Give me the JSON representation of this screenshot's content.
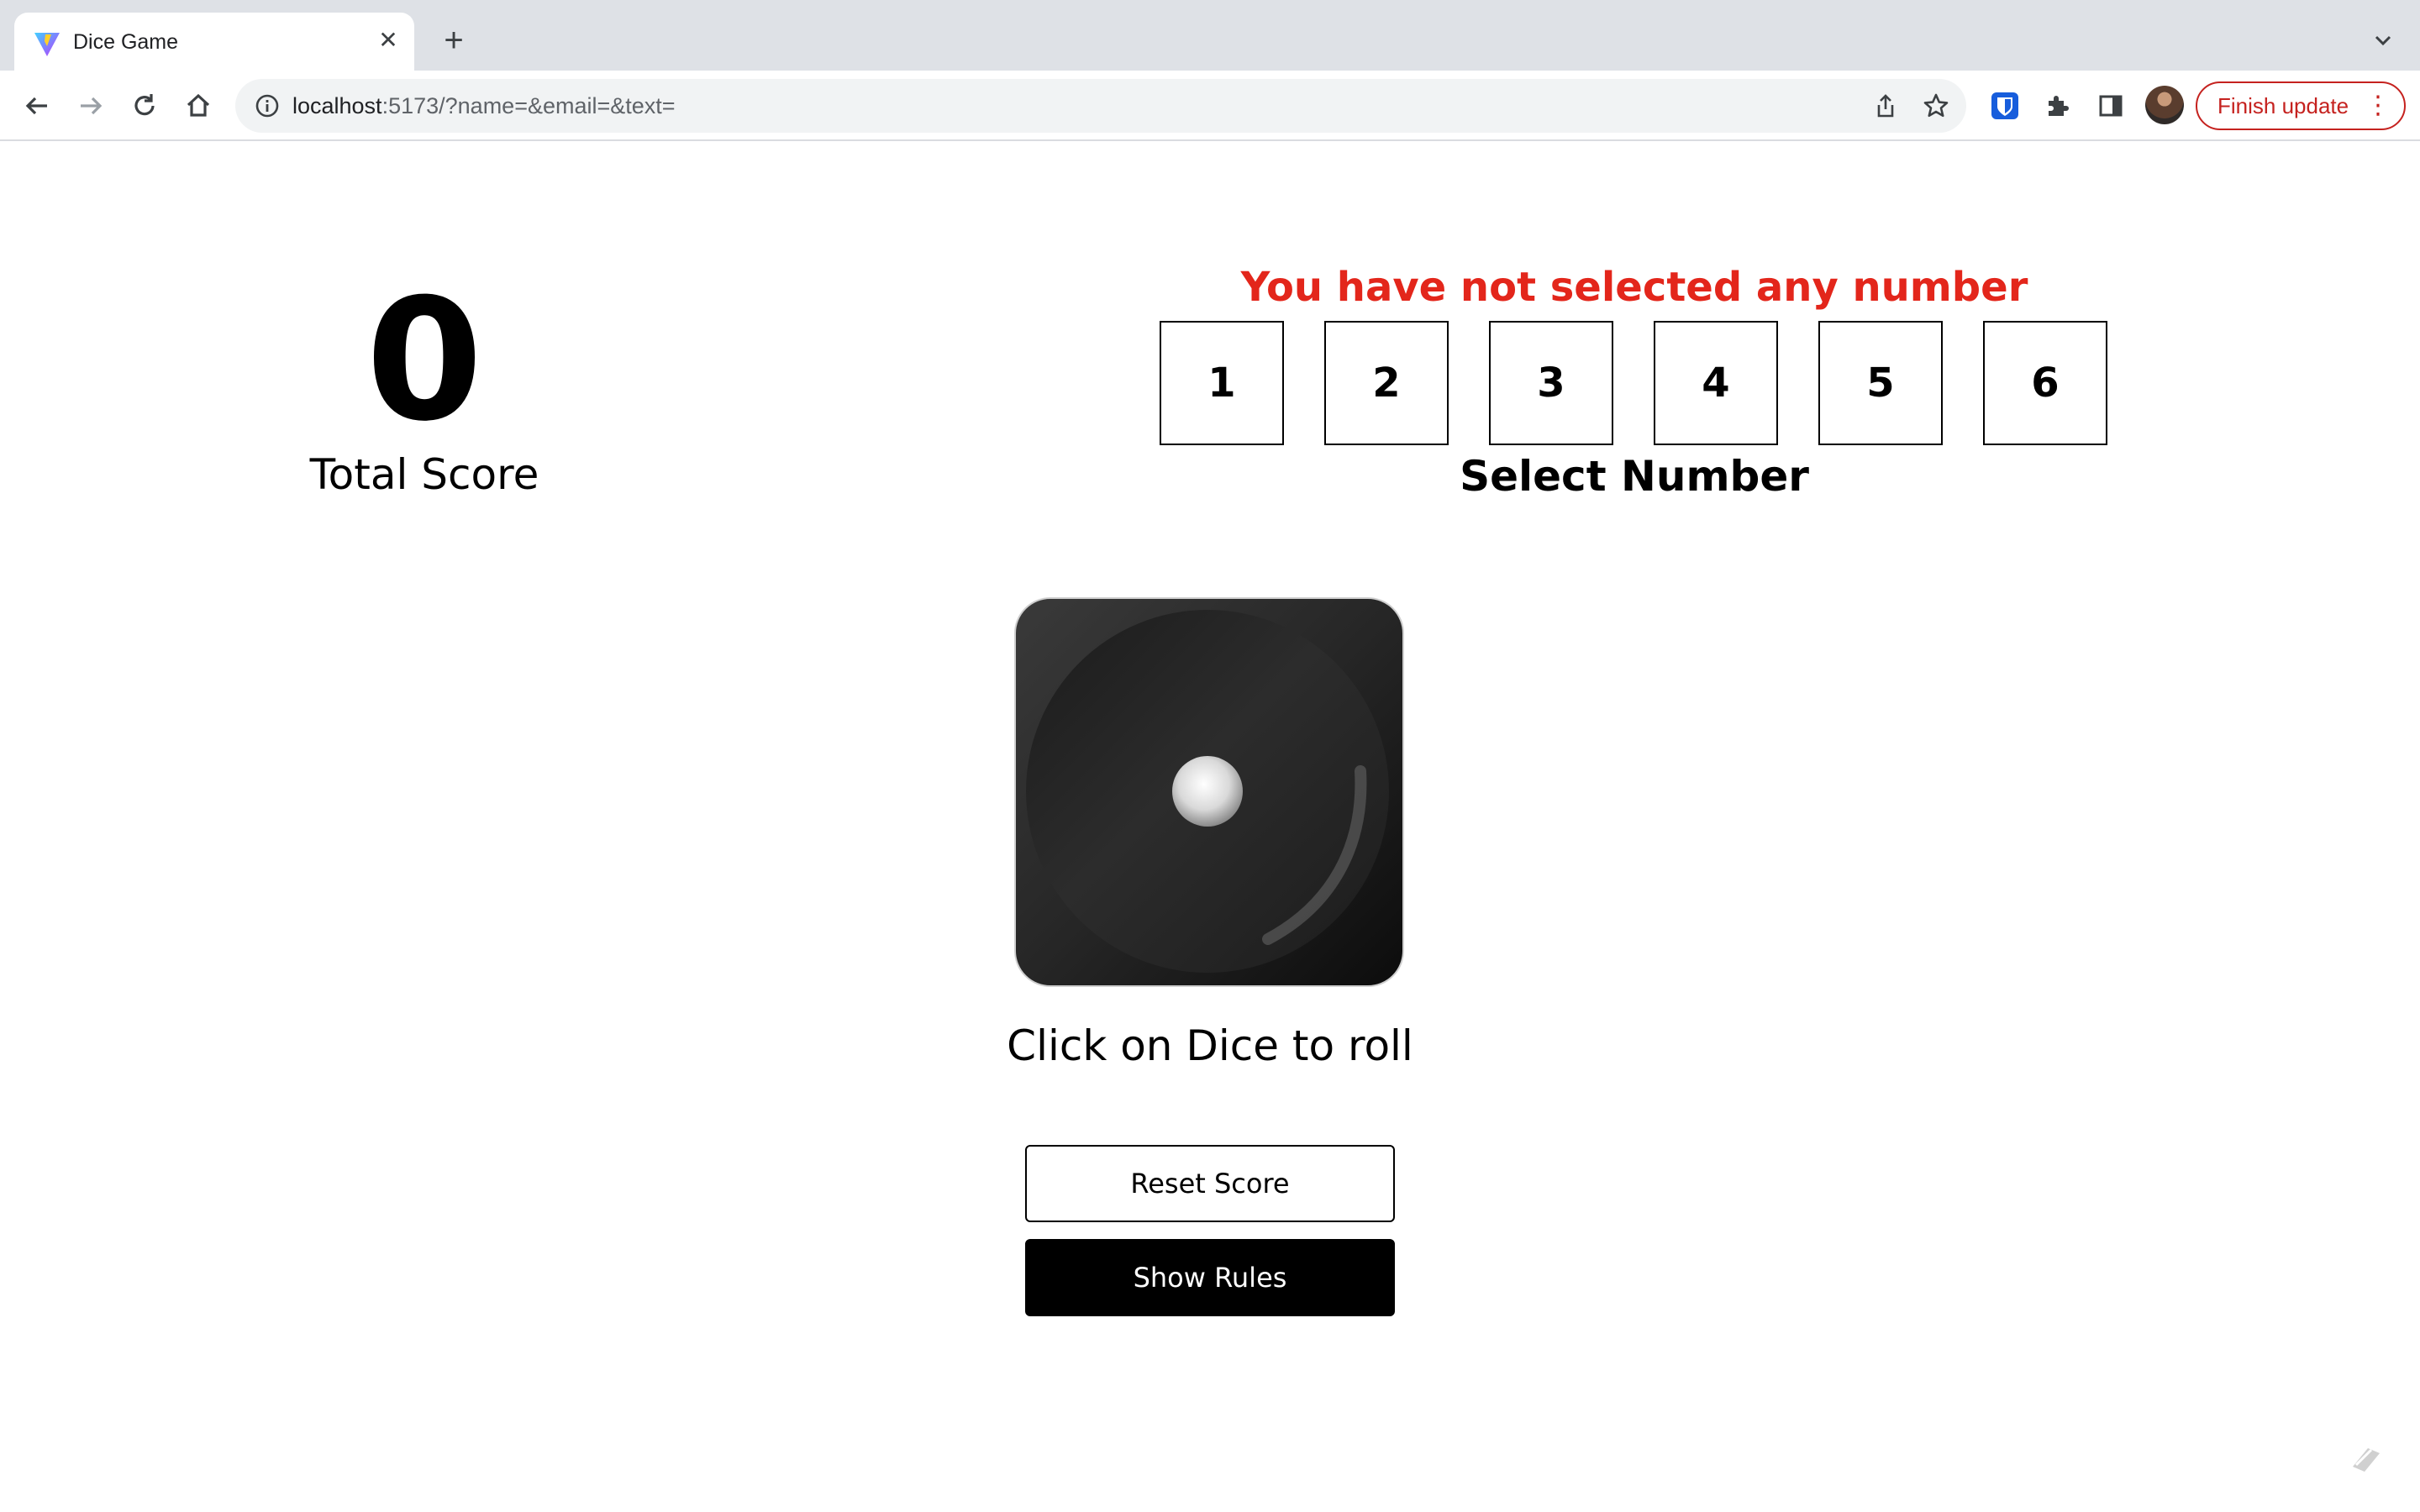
{
  "browser": {
    "tab": {
      "title": "Dice Game",
      "close_icon": "close-icon",
      "favicon": "vite-logo-icon"
    },
    "new_tab_icon": "plus-icon",
    "tab_search_icon": "chevron-down-icon",
    "address": {
      "host": "localhost",
      "path": ":5173/?name=&email=&text="
    },
    "update_button": {
      "label": "Finish update"
    },
    "icons": [
      "back-arrow-icon",
      "forward-arrow-icon",
      "reload-icon",
      "home-icon",
      "info-icon",
      "share-icon",
      "star-icon",
      "bitwarden-icon",
      "extensions-icon",
      "side-panel-icon",
      "avatar",
      "more-vert-icon"
    ],
    "colors": {
      "update_accent": "#c5221f",
      "tabstrip_bg": "#dee1e6",
      "omnibox_bg": "#f1f3f4"
    }
  },
  "game": {
    "score": {
      "value": "0",
      "label": "Total Score"
    },
    "error_message": "You have not selected any number",
    "numbers": [
      "1",
      "2",
      "3",
      "4",
      "5",
      "6"
    ],
    "select_label": "Select Number",
    "dice_face": 1,
    "dice_caption": "Click on Dice to roll",
    "reset_button": "Reset Score",
    "rules_button": "Show Rules",
    "colors": {
      "error": "#e3261b",
      "primary": "#000000"
    }
  }
}
